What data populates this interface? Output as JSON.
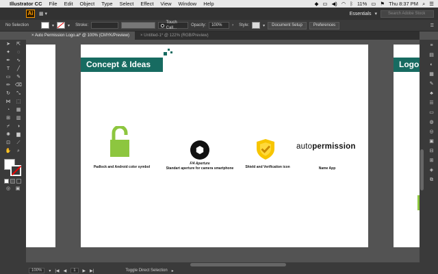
{
  "menubar": {
    "app": "Illustrator CC",
    "items": [
      "File",
      "Edit",
      "Object",
      "Type",
      "Select",
      "Effect",
      "View",
      "Window",
      "Help"
    ],
    "battery": "11%",
    "clock": "Thu 8:37 PM"
  },
  "appbar": {
    "logo": "Ai",
    "workspace": "Essentials",
    "search_placeholder": "Search Adobe Stock"
  },
  "control": {
    "selection": "No Selection",
    "stroke_label": "Stroke:",
    "brush": "Touch Call...",
    "opacity_label": "Opacity:",
    "opacity_value": "100%",
    "style_label": "Style:",
    "doc_setup": "Document Setup",
    "preferences": "Preferences"
  },
  "tabs": [
    {
      "label": "Auto Permission Logo.ai* @ 100% (CMYK/Preview)",
      "active": true
    },
    {
      "label": "Untitled-1* @ 122% (RGB/Preview)",
      "active": false
    }
  ],
  "artboard": {
    "header": "Concept & Ideas",
    "items": [
      {
        "caption": "Padlock and Android color symbol"
      },
      {
        "title": "F/4 Aperture",
        "caption": "Standart aperture for camera smartphone"
      },
      {
        "caption": "Shield and Verification icon"
      },
      {
        "logo_a": "auto",
        "logo_b": "permission",
        "caption": "Name App"
      }
    ],
    "right_header": "Logo"
  },
  "status": {
    "zoom": "100%",
    "page": "1",
    "tool": "Toggle Direct Selection"
  },
  "colors": {
    "teal": "#176b61",
    "lime": "#8dc63f",
    "yellow": "#f7c500"
  }
}
